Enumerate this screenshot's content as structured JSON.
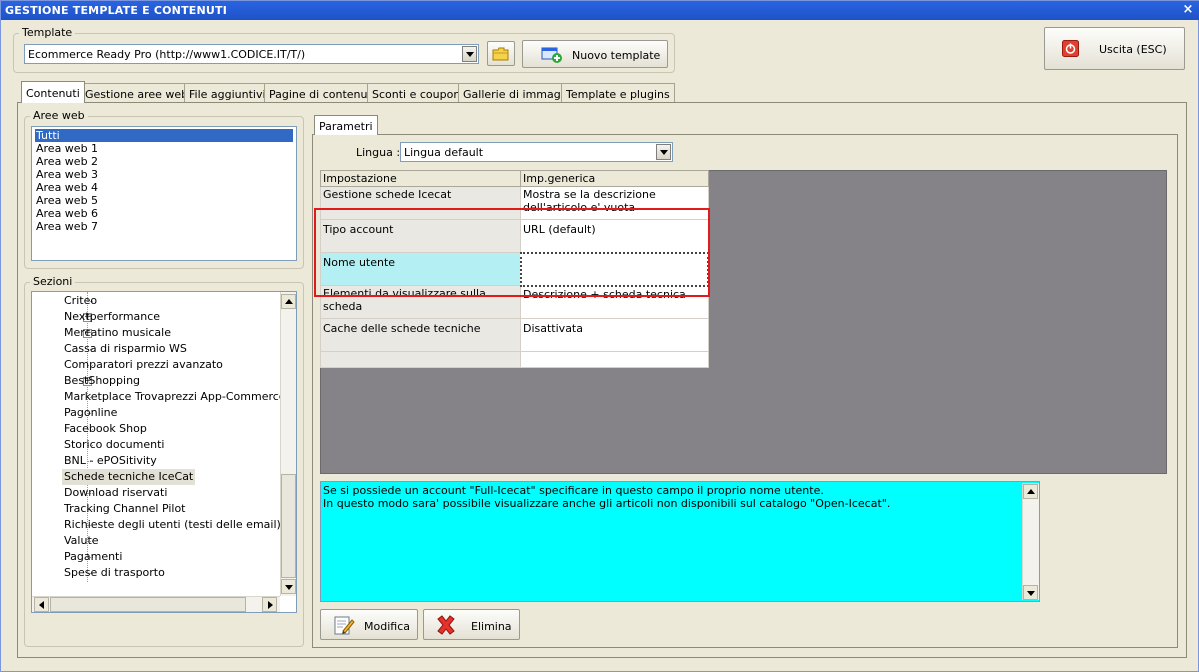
{
  "window": {
    "title": "GESTIONE TEMPLATE E CONTENUTI",
    "close": "×"
  },
  "template": {
    "legend": "Template",
    "selected": "Ecommerce Ready Pro (http://www1.CODICE.IT/T/)",
    "new_button": "Nuovo template"
  },
  "exit_button": "Uscita (ESC)",
  "tabs": [
    "Contenuti",
    "Gestione aree web",
    "File aggiuntivi",
    "Pagine di contenuti",
    "Sconti e coupon",
    "Gallerie di immagini",
    "Template e plugins"
  ],
  "aree_web": {
    "legend": "Aree web",
    "items": [
      "Tutti",
      "Area web 1",
      "Area web 2",
      "Area web 3",
      "Area web 4",
      "Area web 5",
      "Area web 6",
      "Area web 7"
    ]
  },
  "sezioni": {
    "legend": "Sezioni",
    "items": [
      "Criteo",
      "Nextperformance",
      "Mercatino musicale",
      "Cassa di risparmio WS",
      "Comparatori prezzi avanzato",
      "BestShopping",
      "Marketplace Trovaprezzi App-Commerce e Ki",
      "Pagonline",
      "Facebook Shop",
      "Storico documenti",
      "BNL - ePOSitivity",
      "Schede tecniche IceCat",
      "Download riservati",
      "Tracking Channel Pilot",
      "Richieste degli utenti (testi delle email)",
      "Valute",
      "Pagamenti",
      "Spese di trasporto"
    ]
  },
  "parametri": {
    "tab": "Parametri",
    "lingua_label": "Lingua :",
    "lingua_value": "Lingua default",
    "columns": [
      "Impostazione",
      "Imp.generica"
    ],
    "rows": [
      {
        "key": "Gestione schede Icecat",
        "value": "Mostra se la descrizione dell'articolo e' vuota"
      },
      {
        "key": "Tipo account",
        "value": "URL (default)"
      },
      {
        "key": "Nome utente",
        "value": ""
      },
      {
        "key": "Elementi da visualizzare sulla scheda",
        "value": "Descrizione + scheda tecnica"
      },
      {
        "key": "Cache delle schede tecniche",
        "value": "Disattivata"
      }
    ],
    "description": "Se si possiede un account \"Full-Icecat\" specificare in questo campo il proprio nome utente.\nIn questo modo sara' possibile visualizzare anche gli articoli non disponibili sul catalogo \"Open-Icecat\".",
    "modifica": "Modifica",
    "elimina": "Elimina"
  },
  "colors": {
    "title_bar": "#2a64e0",
    "selection": "#316ac5",
    "description_bg": "#00ffff",
    "highlight": "#e11b1b",
    "grid_bg": "#858288"
  }
}
